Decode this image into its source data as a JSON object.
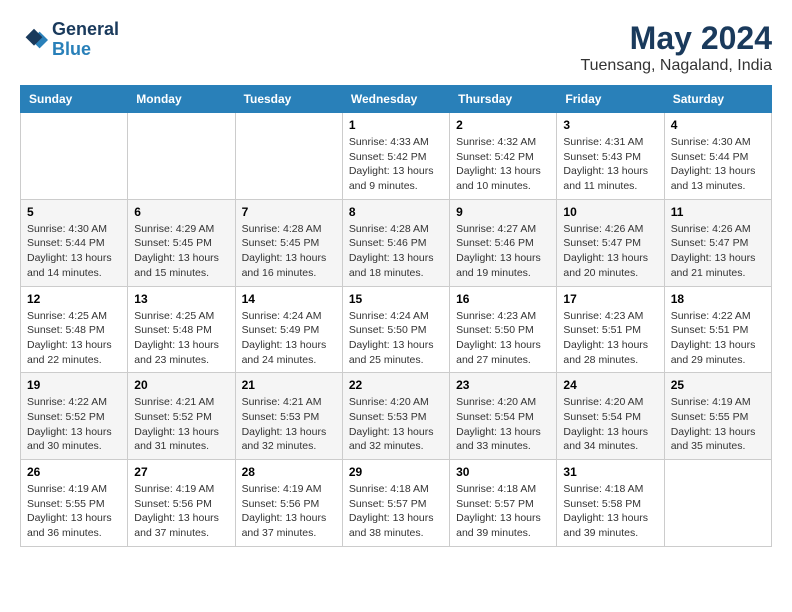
{
  "header": {
    "logo_line1": "General",
    "logo_line2": "Blue",
    "month": "May 2024",
    "location": "Tuensang, Nagaland, India"
  },
  "weekdays": [
    "Sunday",
    "Monday",
    "Tuesday",
    "Wednesday",
    "Thursday",
    "Friday",
    "Saturday"
  ],
  "weeks": [
    [
      {
        "day": "",
        "sunrise": "",
        "sunset": "",
        "daylight": ""
      },
      {
        "day": "",
        "sunrise": "",
        "sunset": "",
        "daylight": ""
      },
      {
        "day": "",
        "sunrise": "",
        "sunset": "",
        "daylight": ""
      },
      {
        "day": "1",
        "sunrise": "Sunrise: 4:33 AM",
        "sunset": "Sunset: 5:42 PM",
        "daylight": "Daylight: 13 hours and 9 minutes."
      },
      {
        "day": "2",
        "sunrise": "Sunrise: 4:32 AM",
        "sunset": "Sunset: 5:42 PM",
        "daylight": "Daylight: 13 hours and 10 minutes."
      },
      {
        "day": "3",
        "sunrise": "Sunrise: 4:31 AM",
        "sunset": "Sunset: 5:43 PM",
        "daylight": "Daylight: 13 hours and 11 minutes."
      },
      {
        "day": "4",
        "sunrise": "Sunrise: 4:30 AM",
        "sunset": "Sunset: 5:44 PM",
        "daylight": "Daylight: 13 hours and 13 minutes."
      }
    ],
    [
      {
        "day": "5",
        "sunrise": "Sunrise: 4:30 AM",
        "sunset": "Sunset: 5:44 PM",
        "daylight": "Daylight: 13 hours and 14 minutes."
      },
      {
        "day": "6",
        "sunrise": "Sunrise: 4:29 AM",
        "sunset": "Sunset: 5:45 PM",
        "daylight": "Daylight: 13 hours and 15 minutes."
      },
      {
        "day": "7",
        "sunrise": "Sunrise: 4:28 AM",
        "sunset": "Sunset: 5:45 PM",
        "daylight": "Daylight: 13 hours and 16 minutes."
      },
      {
        "day": "8",
        "sunrise": "Sunrise: 4:28 AM",
        "sunset": "Sunset: 5:46 PM",
        "daylight": "Daylight: 13 hours and 18 minutes."
      },
      {
        "day": "9",
        "sunrise": "Sunrise: 4:27 AM",
        "sunset": "Sunset: 5:46 PM",
        "daylight": "Daylight: 13 hours and 19 minutes."
      },
      {
        "day": "10",
        "sunrise": "Sunrise: 4:26 AM",
        "sunset": "Sunset: 5:47 PM",
        "daylight": "Daylight: 13 hours and 20 minutes."
      },
      {
        "day": "11",
        "sunrise": "Sunrise: 4:26 AM",
        "sunset": "Sunset: 5:47 PM",
        "daylight": "Daylight: 13 hours and 21 minutes."
      }
    ],
    [
      {
        "day": "12",
        "sunrise": "Sunrise: 4:25 AM",
        "sunset": "Sunset: 5:48 PM",
        "daylight": "Daylight: 13 hours and 22 minutes."
      },
      {
        "day": "13",
        "sunrise": "Sunrise: 4:25 AM",
        "sunset": "Sunset: 5:48 PM",
        "daylight": "Daylight: 13 hours and 23 minutes."
      },
      {
        "day": "14",
        "sunrise": "Sunrise: 4:24 AM",
        "sunset": "Sunset: 5:49 PM",
        "daylight": "Daylight: 13 hours and 24 minutes."
      },
      {
        "day": "15",
        "sunrise": "Sunrise: 4:24 AM",
        "sunset": "Sunset: 5:50 PM",
        "daylight": "Daylight: 13 hours and 25 minutes."
      },
      {
        "day": "16",
        "sunrise": "Sunrise: 4:23 AM",
        "sunset": "Sunset: 5:50 PM",
        "daylight": "Daylight: 13 hours and 27 minutes."
      },
      {
        "day": "17",
        "sunrise": "Sunrise: 4:23 AM",
        "sunset": "Sunset: 5:51 PM",
        "daylight": "Daylight: 13 hours and 28 minutes."
      },
      {
        "day": "18",
        "sunrise": "Sunrise: 4:22 AM",
        "sunset": "Sunset: 5:51 PM",
        "daylight": "Daylight: 13 hours and 29 minutes."
      }
    ],
    [
      {
        "day": "19",
        "sunrise": "Sunrise: 4:22 AM",
        "sunset": "Sunset: 5:52 PM",
        "daylight": "Daylight: 13 hours and 30 minutes."
      },
      {
        "day": "20",
        "sunrise": "Sunrise: 4:21 AM",
        "sunset": "Sunset: 5:52 PM",
        "daylight": "Daylight: 13 hours and 31 minutes."
      },
      {
        "day": "21",
        "sunrise": "Sunrise: 4:21 AM",
        "sunset": "Sunset: 5:53 PM",
        "daylight": "Daylight: 13 hours and 32 minutes."
      },
      {
        "day": "22",
        "sunrise": "Sunrise: 4:20 AM",
        "sunset": "Sunset: 5:53 PM",
        "daylight": "Daylight: 13 hours and 32 minutes."
      },
      {
        "day": "23",
        "sunrise": "Sunrise: 4:20 AM",
        "sunset": "Sunset: 5:54 PM",
        "daylight": "Daylight: 13 hours and 33 minutes."
      },
      {
        "day": "24",
        "sunrise": "Sunrise: 4:20 AM",
        "sunset": "Sunset: 5:54 PM",
        "daylight": "Daylight: 13 hours and 34 minutes."
      },
      {
        "day": "25",
        "sunrise": "Sunrise: 4:19 AM",
        "sunset": "Sunset: 5:55 PM",
        "daylight": "Daylight: 13 hours and 35 minutes."
      }
    ],
    [
      {
        "day": "26",
        "sunrise": "Sunrise: 4:19 AM",
        "sunset": "Sunset: 5:55 PM",
        "daylight": "Daylight: 13 hours and 36 minutes."
      },
      {
        "day": "27",
        "sunrise": "Sunrise: 4:19 AM",
        "sunset": "Sunset: 5:56 PM",
        "daylight": "Daylight: 13 hours and 37 minutes."
      },
      {
        "day": "28",
        "sunrise": "Sunrise: 4:19 AM",
        "sunset": "Sunset: 5:56 PM",
        "daylight": "Daylight: 13 hours and 37 minutes."
      },
      {
        "day": "29",
        "sunrise": "Sunrise: 4:18 AM",
        "sunset": "Sunset: 5:57 PM",
        "daylight": "Daylight: 13 hours and 38 minutes."
      },
      {
        "day": "30",
        "sunrise": "Sunrise: 4:18 AM",
        "sunset": "Sunset: 5:57 PM",
        "daylight": "Daylight: 13 hours and 39 minutes."
      },
      {
        "day": "31",
        "sunrise": "Sunrise: 4:18 AM",
        "sunset": "Sunset: 5:58 PM",
        "daylight": "Daylight: 13 hours and 39 minutes."
      },
      {
        "day": "",
        "sunrise": "",
        "sunset": "",
        "daylight": ""
      }
    ]
  ]
}
